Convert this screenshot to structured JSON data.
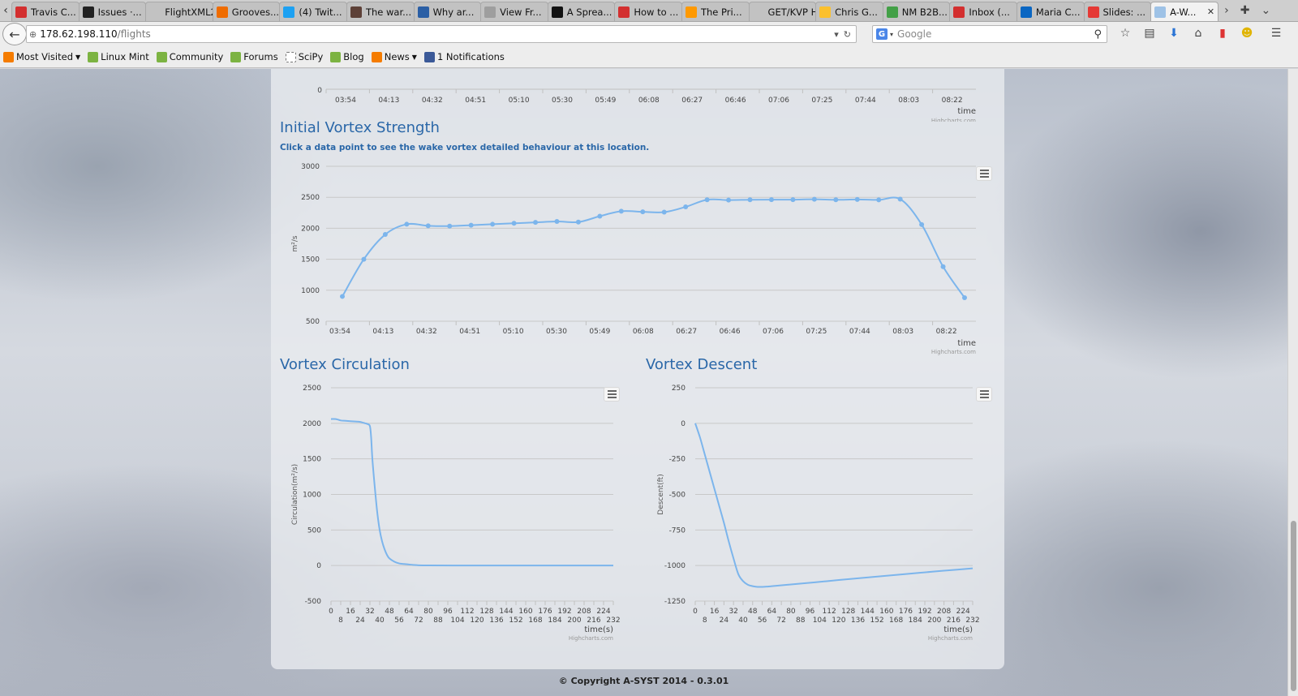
{
  "browser": {
    "tabs": [
      {
        "label": "Travis C...",
        "icon": "travis-icon",
        "color": "#d32f2f"
      },
      {
        "label": "Issues ·...",
        "icon": "github-icon",
        "color": "#222222"
      },
      {
        "label": "FlightXML2...",
        "icon": "blank-page-icon",
        "color": "#c2c2c2"
      },
      {
        "label": "Grooves...",
        "icon": "groove-icon",
        "color": "#ef6c00"
      },
      {
        "label": "(4) Twit...",
        "icon": "twitter-icon",
        "color": "#1da1f2"
      },
      {
        "label": "The war...",
        "icon": "article-icon",
        "color": "#5d4037"
      },
      {
        "label": "Why ar...",
        "icon": "stackexchange-icon",
        "color": "#2b5fa5"
      },
      {
        "label": "View Fr...",
        "icon": "page-icon",
        "color": "#9e9e9e"
      },
      {
        "label": "A Sprea...",
        "icon": "medium-icon",
        "color": "#111111"
      },
      {
        "label": "How to ...",
        "icon": "howto-icon",
        "color": "#d32f2f"
      },
      {
        "label": "The Pri...",
        "icon": "amazon-icon",
        "color": "#ff9900"
      },
      {
        "label": "GET/KVP H...",
        "icon": "blank-page-icon",
        "color": "#c2c2c2"
      },
      {
        "label": "Chris G...",
        "icon": "smiley-icon",
        "color": "#fbc02d"
      },
      {
        "label": "NM B2B...",
        "icon": "star-icon",
        "color": "#43a047"
      },
      {
        "label": "Inbox (...",
        "icon": "gmail-icon",
        "color": "#d32f2f"
      },
      {
        "label": "Maria C...",
        "icon": "linkedin-icon",
        "color": "#0a66c2"
      },
      {
        "label": "Slides: ...",
        "icon": "slides-icon",
        "color": "#e53935"
      },
      {
        "label": "A-W...",
        "icon": "loading-icon",
        "color": "#9ec2e6",
        "active": true
      }
    ],
    "url_host": "178.62.198.110",
    "url_path": "/flights",
    "search_engine": "G",
    "search_placeholder": "Google",
    "bookmarks": [
      {
        "label": "Most Visited",
        "icon": "rss-icon",
        "dropdown": true
      },
      {
        "label": "Linux Mint",
        "icon": "mint-icon",
        "dropdown": false
      },
      {
        "label": "Community",
        "icon": "mint-icon",
        "dropdown": false
      },
      {
        "label": "Forums",
        "icon": "mint-icon",
        "dropdown": false
      },
      {
        "label": "SciPy",
        "icon": "blank-page-icon",
        "dropdown": false
      },
      {
        "label": "Blog",
        "icon": "mint-icon",
        "dropdown": false
      },
      {
        "label": "News",
        "icon": "rss-icon",
        "dropdown": true
      },
      {
        "label": "1 Notifications",
        "icon": "facebook-icon",
        "dropdown": false
      }
    ]
  },
  "page": {
    "footer": "© Copyright A-SYST 2014 - 0.3.01",
    "credits": "Highcharts.com",
    "accent_color": "#7cb5ec",
    "title_color": "#2a67a8"
  },
  "chart_data": [
    {
      "type": "line",
      "id": "previous-chart-axis",
      "title": "",
      "ytick_visible": [
        "0"
      ],
      "xlabel": "time",
      "categories": [
        "03:54",
        "04:13",
        "04:32",
        "04:51",
        "05:10",
        "05:30",
        "05:49",
        "06:08",
        "06:27",
        "06:46",
        "07:06",
        "07:25",
        "07:44",
        "08:03",
        "08:22"
      ]
    },
    {
      "type": "line",
      "id": "initial-vortex-strength",
      "title": "Initial Vortex Strength",
      "subtitle": "Click a data point to see the wake vortex detailed behaviour at this location.",
      "xlabel": "time",
      "ylabel": "m²/s",
      "ylim": [
        500,
        3000
      ],
      "yticks": [
        500,
        1000,
        1500,
        2000,
        2500,
        3000
      ],
      "categories": [
        "03:54",
        "04:13",
        "04:32",
        "04:51",
        "05:10",
        "05:30",
        "05:49",
        "06:08",
        "06:27",
        "06:46",
        "07:06",
        "07:25",
        "07:44",
        "08:03",
        "08:22"
      ],
      "series": [
        {
          "values": [
            900,
            1500,
            1900,
            2065,
            2040,
            2035,
            2050,
            2065,
            2080,
            2095,
            2110,
            2100,
            2195,
            2275,
            2265,
            2260,
            2345,
            2460,
            2455,
            2460,
            2462,
            2462,
            2468,
            2460,
            2465,
            2458,
            2470,
            2060,
            1380,
            880
          ]
        }
      ]
    },
    {
      "type": "line",
      "id": "vortex-circulation",
      "title": "Vortex Circulation",
      "xlabel": "time(s)",
      "ylabel": "Circulation(m²/s)",
      "ylim": [
        -500,
        2500
      ],
      "yticks": [
        -500,
        0,
        500,
        1000,
        1500,
        2000,
        2500
      ],
      "xticks": [
        0,
        8,
        16,
        24,
        32,
        40,
        48,
        56,
        64,
        72,
        80,
        88,
        96,
        104,
        112,
        120,
        128,
        136,
        144,
        152,
        160,
        168,
        176,
        184,
        192,
        200,
        208,
        216,
        224,
        232
      ],
      "series": [
        {
          "x": [
            0,
            4,
            8,
            12,
            16,
            20,
            24,
            28,
            30,
            32,
            33,
            34,
            36,
            38,
            40,
            42,
            44,
            46,
            48,
            52,
            56,
            60,
            64,
            68,
            72,
            80,
            100,
            140,
            180,
            232
          ],
          "values": [
            2060,
            2060,
            2040,
            2035,
            2030,
            2025,
            2020,
            2000,
            1990,
            1960,
            1800,
            1500,
            1100,
            750,
            500,
            340,
            230,
            150,
            100,
            55,
            30,
            22,
            15,
            8,
            4,
            2,
            1,
            0,
            0,
            0
          ]
        }
      ]
    },
    {
      "type": "line",
      "id": "vortex-descent",
      "title": "Vortex Descent",
      "xlabel": "time(s)",
      "ylabel": "Descent(ft)",
      "ylim": [
        -1250,
        250
      ],
      "yticks": [
        -1250,
        -1000,
        -750,
        -500,
        -250,
        0,
        250
      ],
      "xticks": [
        0,
        8,
        16,
        24,
        32,
        40,
        48,
        56,
        64,
        72,
        80,
        88,
        96,
        104,
        112,
        120,
        128,
        136,
        144,
        152,
        160,
        168,
        176,
        184,
        192,
        200,
        208,
        216,
        224,
        232
      ],
      "series": [
        {
          "x": [
            0,
            4,
            8,
            12,
            16,
            20,
            24,
            28,
            32,
            36,
            40,
            44,
            48,
            52,
            56,
            60,
            64,
            80,
            100,
            120,
            140,
            160,
            180,
            200,
            220,
            232
          ],
          "values": [
            0,
            -100,
            -220,
            -340,
            -460,
            -580,
            -700,
            -830,
            -950,
            -1060,
            -1110,
            -1135,
            -1145,
            -1150,
            -1150,
            -1148,
            -1145,
            -1133,
            -1118,
            -1102,
            -1087,
            -1072,
            -1057,
            -1042,
            -1028,
            -1020
          ]
        }
      ]
    }
  ]
}
